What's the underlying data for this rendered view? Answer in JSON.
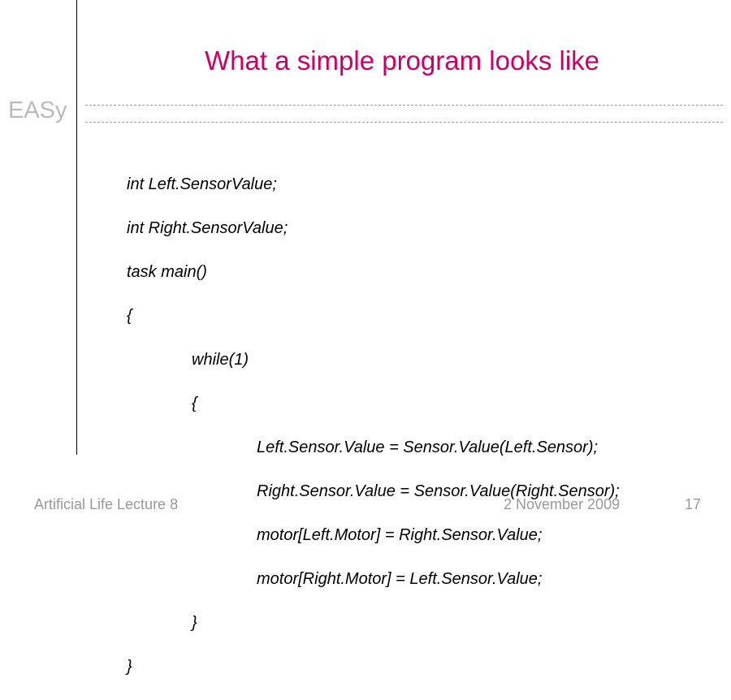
{
  "title": "What a simple program looks like",
  "brand": "EASy",
  "code": {
    "l1": "int Left.SensorValue;",
    "l2": "int Right.SensorValue;",
    "l3": "task main()",
    "l4": "{",
    "l5": "while(1)",
    "l6": "{",
    "l7": "Left.Sensor.Value = Sensor.Value(Left.Sensor);",
    "l8": "Right.Sensor.Value = Sensor.Value(Right.Sensor);",
    "l9": "motor[Left.Motor] = Right.Sensor.Value;",
    "l10": "motor[Right.Motor] = Left.Sensor.Value;",
    "l11": "}",
    "l12": "}"
  },
  "footer": {
    "left": "Artificial Life Lecture 8",
    "date": "2 November 2009",
    "page": "17"
  }
}
